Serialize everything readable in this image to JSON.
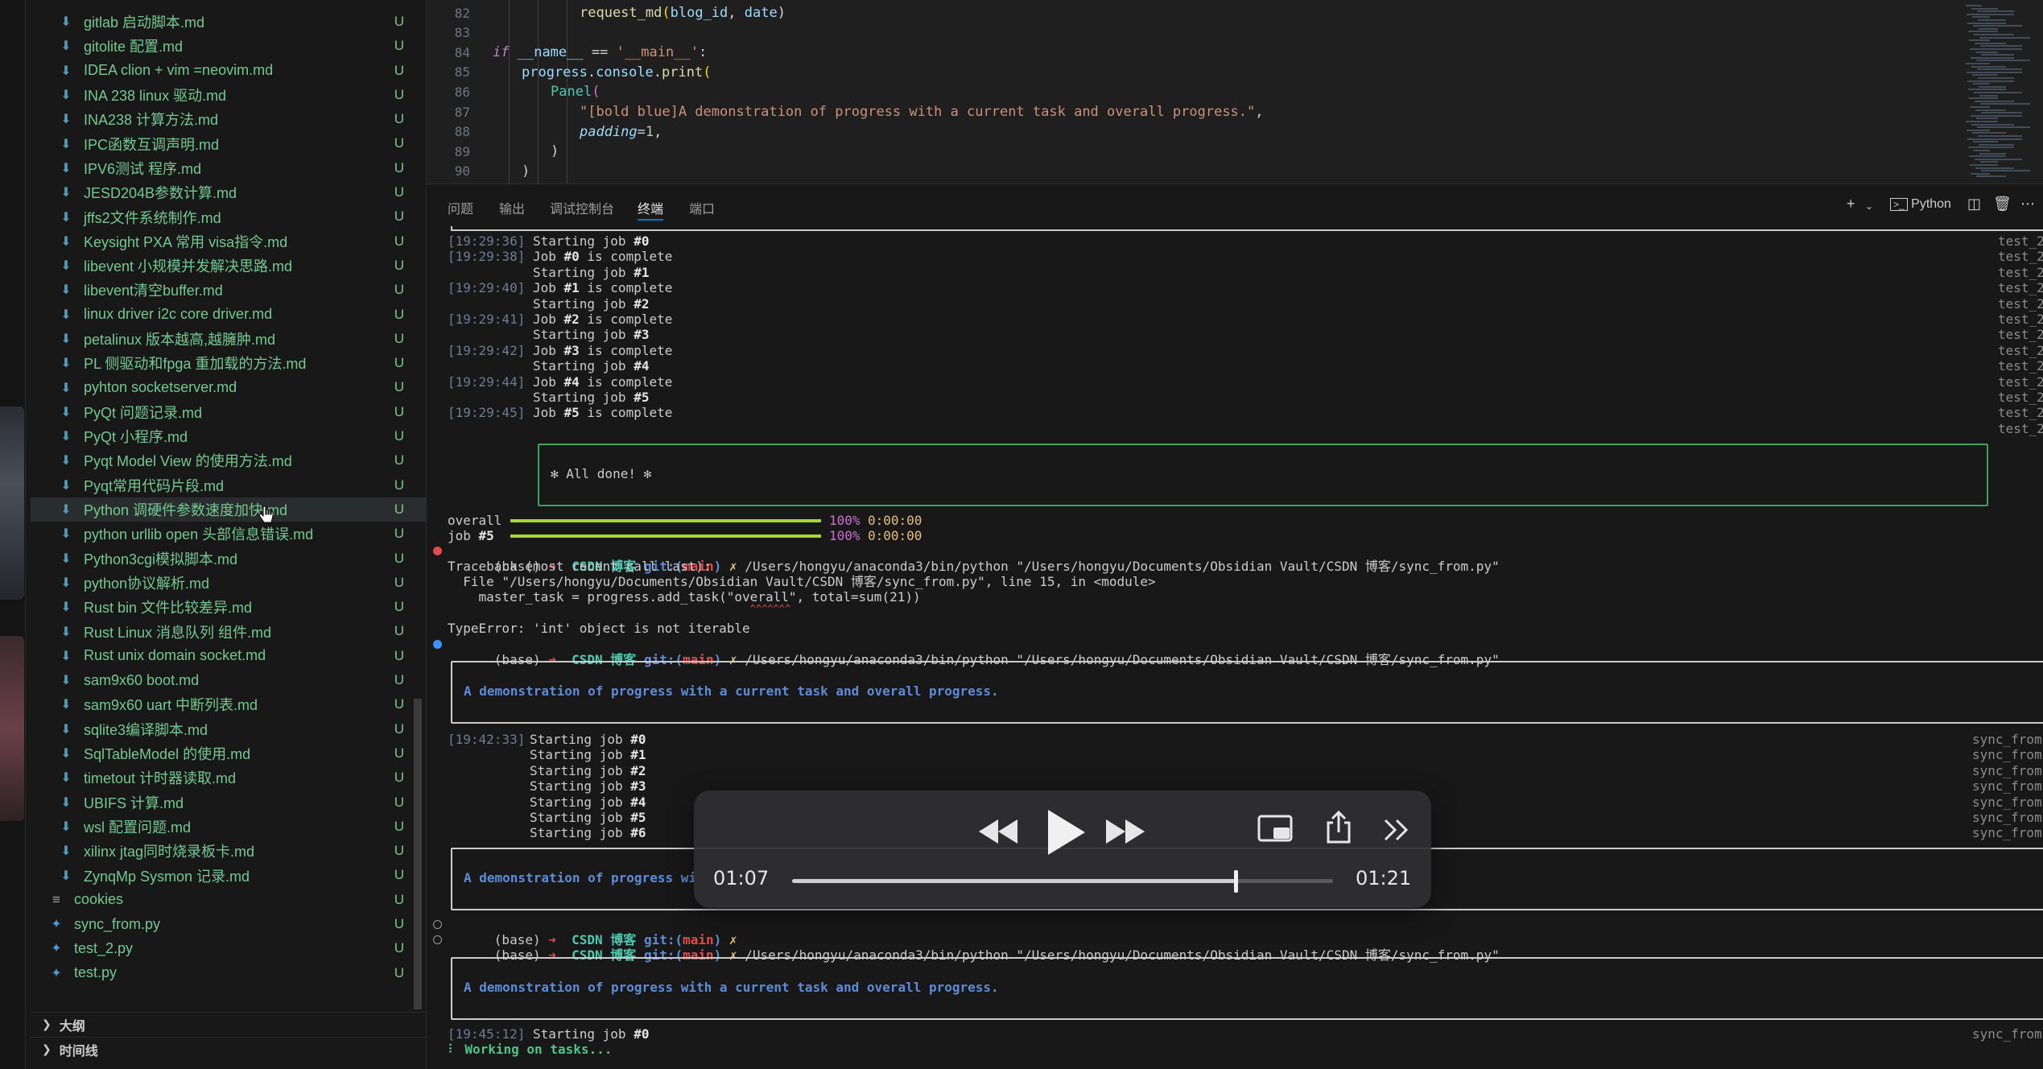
{
  "sidebar": {
    "files": [
      {
        "name": "gitlab 启动脚本.md",
        "status": "U",
        "type": "md"
      },
      {
        "name": "gitolite 配置.md",
        "status": "U",
        "type": "md"
      },
      {
        "name": "IDEA clion + vim =neovim.md",
        "status": "U",
        "type": "md"
      },
      {
        "name": "INA 238 linux 驱动.md",
        "status": "U",
        "type": "md"
      },
      {
        "name": "INA238 计算方法.md",
        "status": "U",
        "type": "md"
      },
      {
        "name": "IPC函数互调声明.md",
        "status": "U",
        "type": "md"
      },
      {
        "name": "IPV6测试 程序.md",
        "status": "U",
        "type": "md"
      },
      {
        "name": "JESD204B参数计算.md",
        "status": "U",
        "type": "md"
      },
      {
        "name": "jffs2文件系统制作.md",
        "status": "U",
        "type": "md"
      },
      {
        "name": "Keysight PXA 常用 visa指令.md",
        "status": "U",
        "type": "md"
      },
      {
        "name": "libevent 小规模并发解决思路.md",
        "status": "U",
        "type": "md"
      },
      {
        "name": "libevent清空buffer.md",
        "status": "U",
        "type": "md"
      },
      {
        "name": "linux driver i2c core driver.md",
        "status": "U",
        "type": "md"
      },
      {
        "name": "petalinux 版本越高,越臃肿.md",
        "status": "U",
        "type": "md"
      },
      {
        "name": "PL 侧驱动和fpga 重加载的方法.md",
        "status": "U",
        "type": "md"
      },
      {
        "name": "pyhton socketserver.md",
        "status": "U",
        "type": "md"
      },
      {
        "name": "PyQt 问题记录.md",
        "status": "U",
        "type": "md"
      },
      {
        "name": "PyQt 小程序.md",
        "status": "U",
        "type": "md"
      },
      {
        "name": "Pyqt Model View 的使用方法.md",
        "status": "U",
        "type": "md"
      },
      {
        "name": "Pyqt常用代码片段.md",
        "status": "U",
        "type": "md"
      },
      {
        "name": "Python 调硬件参数速度加快.md",
        "status": "U",
        "type": "md",
        "selected": true
      },
      {
        "name": "python urllib open 头部信息错误.md",
        "status": "U",
        "type": "md"
      },
      {
        "name": "Python3cgi模拟脚本.md",
        "status": "U",
        "type": "md"
      },
      {
        "name": "python协议解析.md",
        "status": "U",
        "type": "md"
      },
      {
        "name": "Rust bin 文件比较差异.md",
        "status": "U",
        "type": "md"
      },
      {
        "name": "Rust Linux 消息队列 组件.md",
        "status": "U",
        "type": "md"
      },
      {
        "name": "Rust unix domain socket.md",
        "status": "U",
        "type": "md"
      },
      {
        "name": "sam9x60 boot.md",
        "status": "U",
        "type": "md"
      },
      {
        "name": "sam9x60 uart 中断列表.md",
        "status": "U",
        "type": "md"
      },
      {
        "name": "sqlite3编译脚本.md",
        "status": "U",
        "type": "md"
      },
      {
        "name": "SqlTableModel 的使用.md",
        "status": "U",
        "type": "md"
      },
      {
        "name": "timetout 计时器读取.md",
        "status": "U",
        "type": "md"
      },
      {
        "name": "UBIFS 计算.md",
        "status": "U",
        "type": "md"
      },
      {
        "name": "wsl 配置问题.md",
        "status": "U",
        "type": "md"
      },
      {
        "name": "xilinx jtag同时烧录板卡.md",
        "status": "U",
        "type": "md"
      },
      {
        "name": "ZynqMp Sysmon 记录.md",
        "status": "U",
        "type": "md"
      },
      {
        "name": "cookies",
        "status": "U",
        "type": "cfg",
        "root": true
      },
      {
        "name": "sync_from.py",
        "status": "U",
        "type": "py",
        "root": true
      },
      {
        "name": "test_2.py",
        "status": "U",
        "type": "py",
        "root": true
      },
      {
        "name": "test.py",
        "status": "U",
        "type": "py",
        "root": true
      }
    ],
    "outline_label": "大纲",
    "timeline_label": "时间线"
  },
  "editor": {
    "lines": [
      {
        "num": "82",
        "indent": 3,
        "text": "request_md(blog_id, date)"
      },
      {
        "num": "83",
        "indent": 0,
        "text": ""
      },
      {
        "num": "84",
        "indent": 0,
        "text": "if __name__ == '__main__':"
      },
      {
        "num": "85",
        "indent": 1,
        "text": "progress.console.print("
      },
      {
        "num": "86",
        "indent": 2,
        "text": "Panel("
      },
      {
        "num": "87",
        "indent": 3,
        "text": "\"[bold blue]A demonstration of progress with a current task and overall progress.\","
      },
      {
        "num": "88",
        "indent": 3,
        "text": "padding=1,"
      },
      {
        "num": "89",
        "indent": 2,
        "text": ")"
      },
      {
        "num": "90",
        "indent": 1,
        "text": ")"
      }
    ]
  },
  "panel": {
    "tabs": [
      "问题",
      "输出",
      "调试控制台",
      "终端",
      "端口"
    ],
    "active_tab": "终端",
    "shell_label": "Python"
  },
  "terminal": {
    "run1": [
      {
        "ts": "[19:29:36]",
        "text": "Starting job ",
        "job": "#0",
        "suffix": ""
      },
      {
        "ts": "[19:29:38]",
        "text": "Job ",
        "job": "#0",
        "suffix": " is complete"
      },
      {
        "ts": "",
        "text": "Starting job ",
        "job": "#1",
        "suffix": ""
      },
      {
        "ts": "[19:29:40]",
        "text": "Job ",
        "job": "#1",
        "suffix": " is complete"
      },
      {
        "ts": "",
        "text": "Starting job ",
        "job": "#2",
        "suffix": ""
      },
      {
        "ts": "[19:29:41]",
        "text": "Job ",
        "job": "#2",
        "suffix": " is complete"
      },
      {
        "ts": "",
        "text": "Starting job ",
        "job": "#3",
        "suffix": ""
      },
      {
        "ts": "[19:29:42]",
        "text": "Job ",
        "job": "#3",
        "suffix": " is complete"
      },
      {
        "ts": "",
        "text": "Starting job ",
        "job": "#4",
        "suffix": ""
      },
      {
        "ts": "[19:29:44]",
        "text": "Job ",
        "job": "#4",
        "suffix": " is complete"
      },
      {
        "ts": "",
        "text": "Starting job ",
        "job": "#5",
        "suffix": ""
      },
      {
        "ts": "[19:29:45]",
        "text": "Job ",
        "job": "#5",
        "suffix": " is complete"
      }
    ],
    "run1_files": [
      "test_2",
      "test_2",
      "test_2",
      "test_2",
      "test_2",
      "test_2",
      "test_2",
      "test_2",
      "test_2",
      "test_2",
      "test_2",
      "test_2",
      "test_2"
    ],
    "all_done": "✻ All done! ✻",
    "overall_label": "overall",
    "overall_pct": "100%",
    "overall_time": "0:00:00",
    "job_label": "job",
    "job_num": "#5",
    "job_pct": "100%",
    "job_time": "0:00:00",
    "prompt_base": "(base)",
    "prompt_arrow": "➜",
    "prompt_dir": "CSDN 博客",
    "prompt_git": "git:(",
    "prompt_branch": "main",
    "prompt_git_close": ")",
    "prompt_x": "✗",
    "cmd": "/Users/hongyu/anaconda3/bin/python \"/Users/hongyu/Documents/Obsidian Vault/CSDN 博客/sync_from.py\"",
    "traceback": "Traceback (most recent call last):",
    "tb_file": "  File \"/Users/hongyu/Documents/Obsidian Vault/CSDN 博客/sync_from.py\", line 15, in <module>",
    "tb_code": "    master_task = progress.add_task(\"overall\", total=sum(21))",
    "tb_caret": "                                                    ^^^^^^^",
    "type_error": "TypeError: 'int' object is not iterable",
    "demo_text": "A demonstration of progress with a current task and overall progress.",
    "demo_text_cut": "A demonstration of progress wi",
    "run2_ts": "[19:42:33]",
    "run2": [
      "#0",
      "#1",
      "#2",
      "#3",
      "#4",
      "#5",
      "#6"
    ],
    "run2_prefix": "Starting job ",
    "run2_files": [
      "sync_from",
      "sync_from",
      "sync_from",
      "sync_from",
      "sync_from",
      "sync_from",
      "sync_from"
    ],
    "run3_ts": "[19:45:12]",
    "run3_text": "Starting job ",
    "run3_job": "#0",
    "run3_file": "sync_from",
    "working": "Working on tasks...",
    "working_spin": "⠇"
  },
  "media": {
    "elapsed": "01:07",
    "remaining": "01:21",
    "progress": 0.82
  },
  "colors": {
    "accent": "#0078d4",
    "git_untracked": "#73c991",
    "success_box": "#3aa35c",
    "progress_bar": "#a6d63a"
  }
}
